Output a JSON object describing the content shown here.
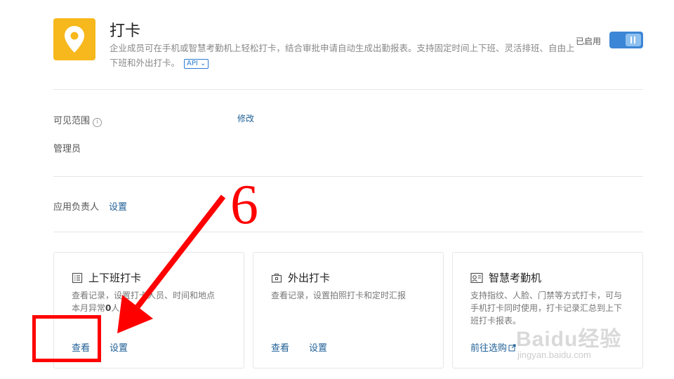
{
  "app": {
    "title": "打卡",
    "description": "企业成员可在手机或智慧考勤机上轻松打卡，结合审批申请自动生成出勤报表。支持固定时间上下班、灵活排班、自由上下班和外出打卡。",
    "api_badge": "API",
    "status_label": "已启用",
    "enabled": true,
    "icon": "location-pin-icon",
    "icon_color": "#f6b81c",
    "accent_color": "#3b86d6"
  },
  "visibility": {
    "label": "可见范围",
    "edit_link": "修改",
    "value": "管理员"
  },
  "owner": {
    "label": "应用负责人",
    "link": "设置"
  },
  "cards": [
    {
      "title": "上下班打卡",
      "icon": "list-icon",
      "desc": "查看记录，设置打卡人员、时间和地点",
      "sub_prefix": "本月异常",
      "sub_value": "0",
      "sub_suffix": "人",
      "links": [
        "查看",
        "设置"
      ]
    },
    {
      "title": "外出打卡",
      "icon": "briefcase-icon",
      "desc": "查看记录，设置拍照打卡和定时汇报",
      "links": [
        "查看",
        "设置"
      ]
    },
    {
      "title": "智慧考勤机",
      "icon": "attendance-machine-icon",
      "desc": "支持指纹、人脸、门禁等方式打卡，可与手机打卡同时使用，打卡记录汇总到上下班打卡报表。",
      "links": [
        "前往选购"
      ]
    }
  ],
  "annotation": {
    "step_number": "6",
    "color": "#ff0000"
  },
  "watermark": {
    "main": "Baidu经验",
    "sub": "jingyan.baidu.com"
  }
}
